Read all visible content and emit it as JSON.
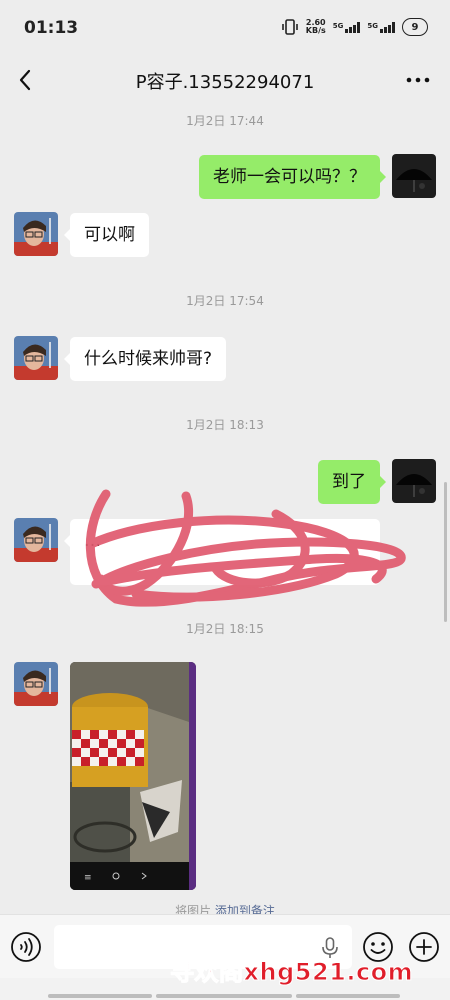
{
  "status_bar": {
    "time": "01:13",
    "net_speed_value": "2.60",
    "net_speed_unit": "KB/s",
    "signal_1_label": "5G",
    "signal_2_label": "5G",
    "battery": "9"
  },
  "header": {
    "title": "P容子.13552294071",
    "back_icon": "chevron-left-icon",
    "more_icon": "more-horizontal-icon"
  },
  "messages": [
    {
      "type": "timestamp",
      "text": "1月2日 17:44"
    },
    {
      "type": "text",
      "sender": "self",
      "text": "老师一会可以吗？？"
    },
    {
      "type": "text",
      "sender": "contact",
      "text": "可以啊"
    },
    {
      "type": "timestamp",
      "text": "1月2日 17:54"
    },
    {
      "type": "text",
      "sender": "contact",
      "text": "什么时候来帅哥?"
    },
    {
      "type": "timestamp",
      "text": "1月2日 18:13"
    },
    {
      "type": "text",
      "sender": "self",
      "text": "到了"
    },
    {
      "type": "text",
      "sender": "contact",
      "text": "…",
      "redacted": true
    },
    {
      "type": "timestamp",
      "text": "1月2日 18:15"
    },
    {
      "type": "image",
      "sender": "contact"
    }
  ],
  "partial_notice": {
    "text": "将图片",
    "link": "添加到备注"
  },
  "input_bar": {
    "placeholder": "",
    "voice_icon": "voice-icon",
    "mic_icon": "microphone-icon",
    "emoji_icon": "emoji-icon",
    "plus_icon": "plus-icon"
  },
  "watermark": "寻欢阁xhg521.com",
  "colors": {
    "background": "#ededed",
    "bubble_out": "#95ec69",
    "bubble_in": "#ffffff",
    "watermark": "#e01e2a",
    "redaction": "#e05a6e"
  }
}
